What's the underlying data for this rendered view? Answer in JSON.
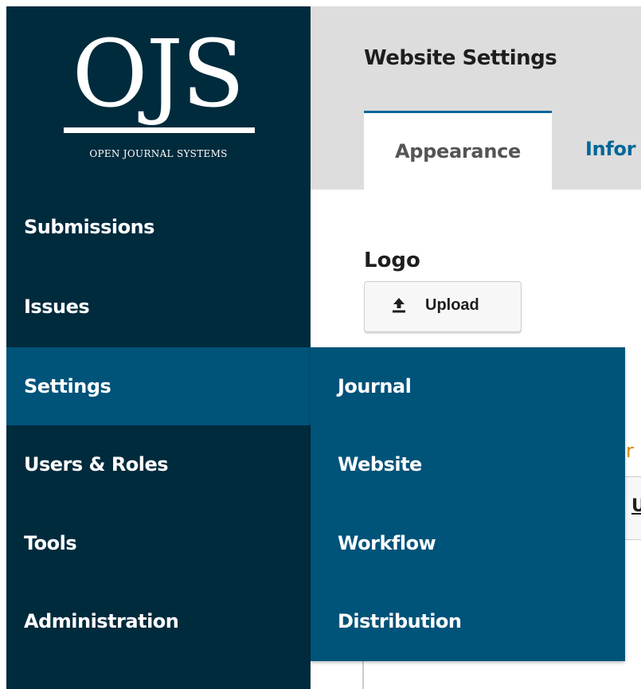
{
  "brand": {
    "logo_mark": "OJS",
    "logo_subtitle": "OPEN JOURNAL SYSTEMS"
  },
  "sidebar": {
    "items": [
      {
        "label": "Submissions"
      },
      {
        "label": "Issues"
      },
      {
        "label": "Settings",
        "active": true
      },
      {
        "label": "Users & Roles"
      },
      {
        "label": "Tools"
      },
      {
        "label": "Administration"
      }
    ]
  },
  "submenu": {
    "items": [
      {
        "label": "Journal"
      },
      {
        "label": "Website"
      },
      {
        "label": "Workflow"
      },
      {
        "label": "Distribution"
      }
    ]
  },
  "header": {
    "title": "Website Settings",
    "tabs": [
      {
        "label": "Appearance",
        "active": true
      },
      {
        "label": "Infor"
      }
    ]
  },
  "content": {
    "logo_section": {
      "label": "Logo",
      "upload_button": {
        "label": "Upload",
        "icon": "upload-icon"
      }
    },
    "partially_hidden": {
      "label_fragment": "r",
      "button_fragment": "U"
    }
  },
  "colors": {
    "sidebar_bg": "#002b3d",
    "active_bg": "#005379",
    "header_bg": "#dddddd",
    "tab_accent": "#006798",
    "warning_text": "#d08a00"
  }
}
